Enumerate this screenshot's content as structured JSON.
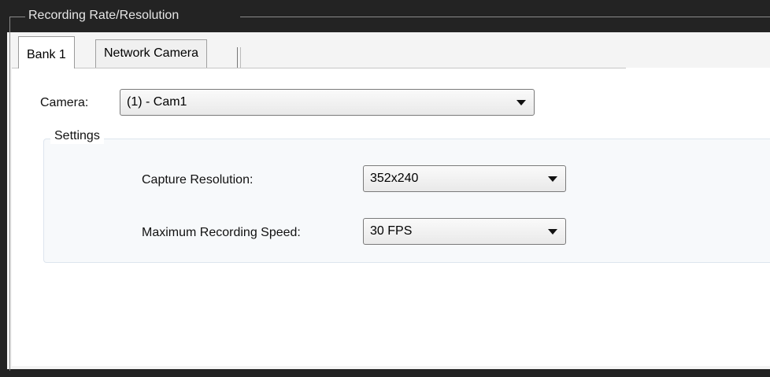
{
  "group": {
    "title": "Recording Rate/Resolution"
  },
  "tabs": [
    {
      "label": "Bank 1",
      "active": true
    },
    {
      "label": "Network Camera",
      "active": false
    }
  ],
  "camera": {
    "label": "Camera:",
    "value": "(1) - Cam1"
  },
  "settings": {
    "title": "Settings",
    "capture_resolution": {
      "label": "Capture Resolution:",
      "value": "352x240"
    },
    "max_recording_speed": {
      "label": "Maximum Recording Speed:",
      "value": "30 FPS"
    }
  },
  "icons": {
    "dropdown": "chevron-down-icon"
  },
  "colors": {
    "frame": "#232323",
    "border": "#7a7a7a"
  }
}
